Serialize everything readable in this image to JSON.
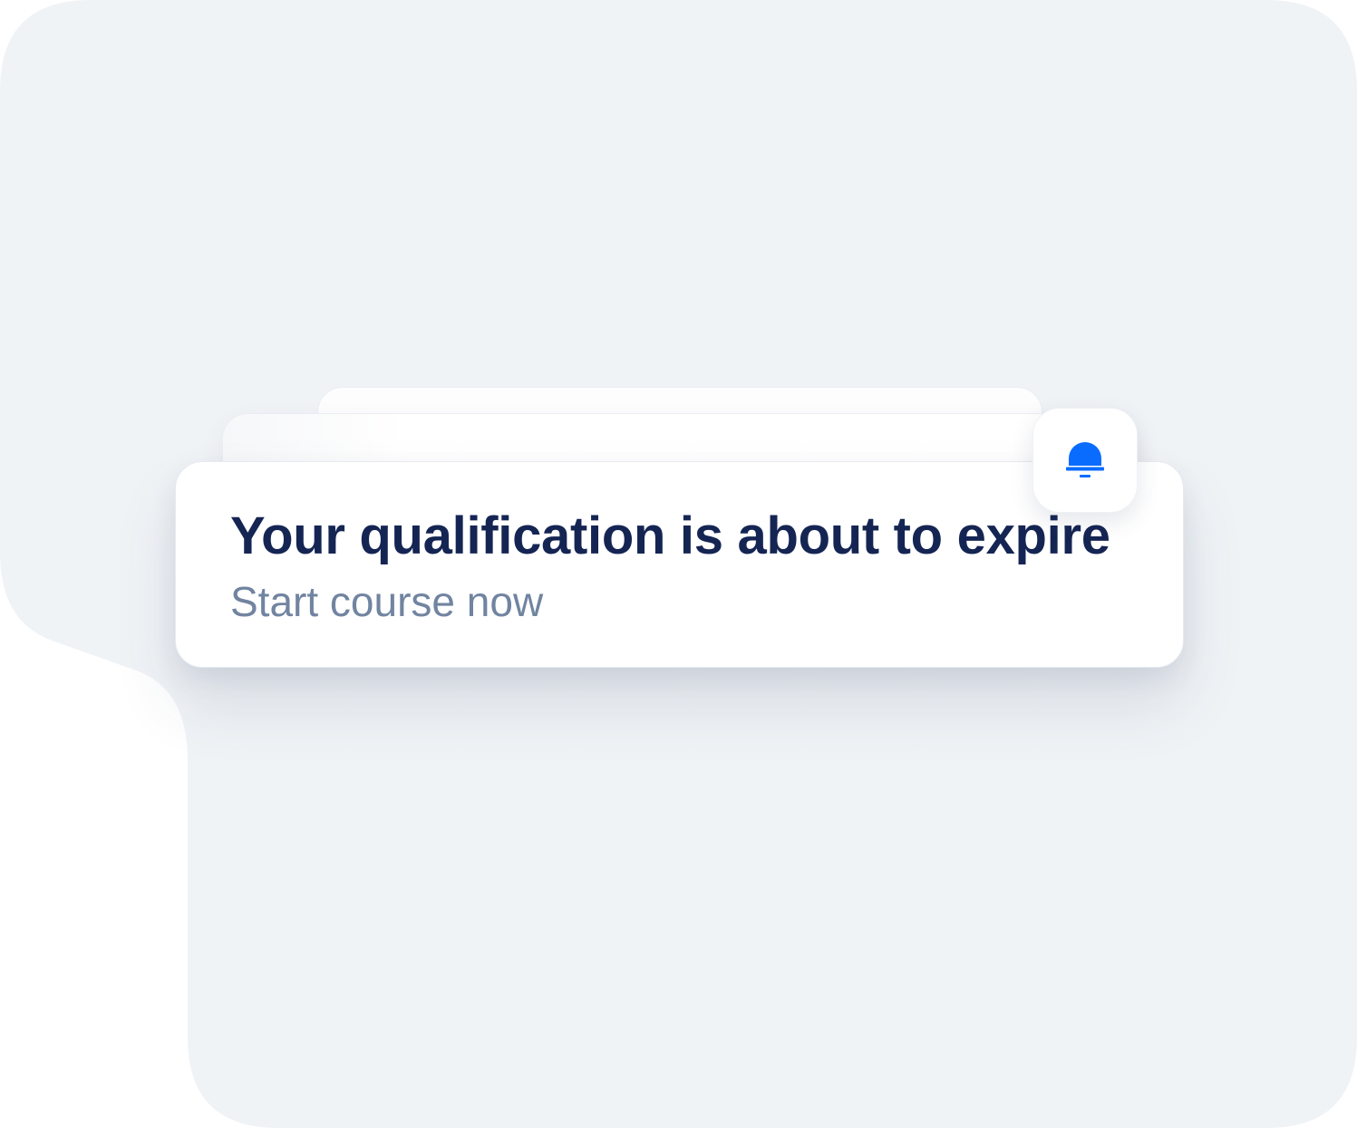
{
  "notification": {
    "title": "Your qualification is about to expire",
    "subtitle": "Start course now",
    "icon": "bell-icon"
  },
  "colors": {
    "background_shape": "#f0f3f6",
    "card": "#ffffff",
    "title_text": "#152553",
    "subtitle_text": "#7184a0",
    "accent": "#0a6cff"
  }
}
